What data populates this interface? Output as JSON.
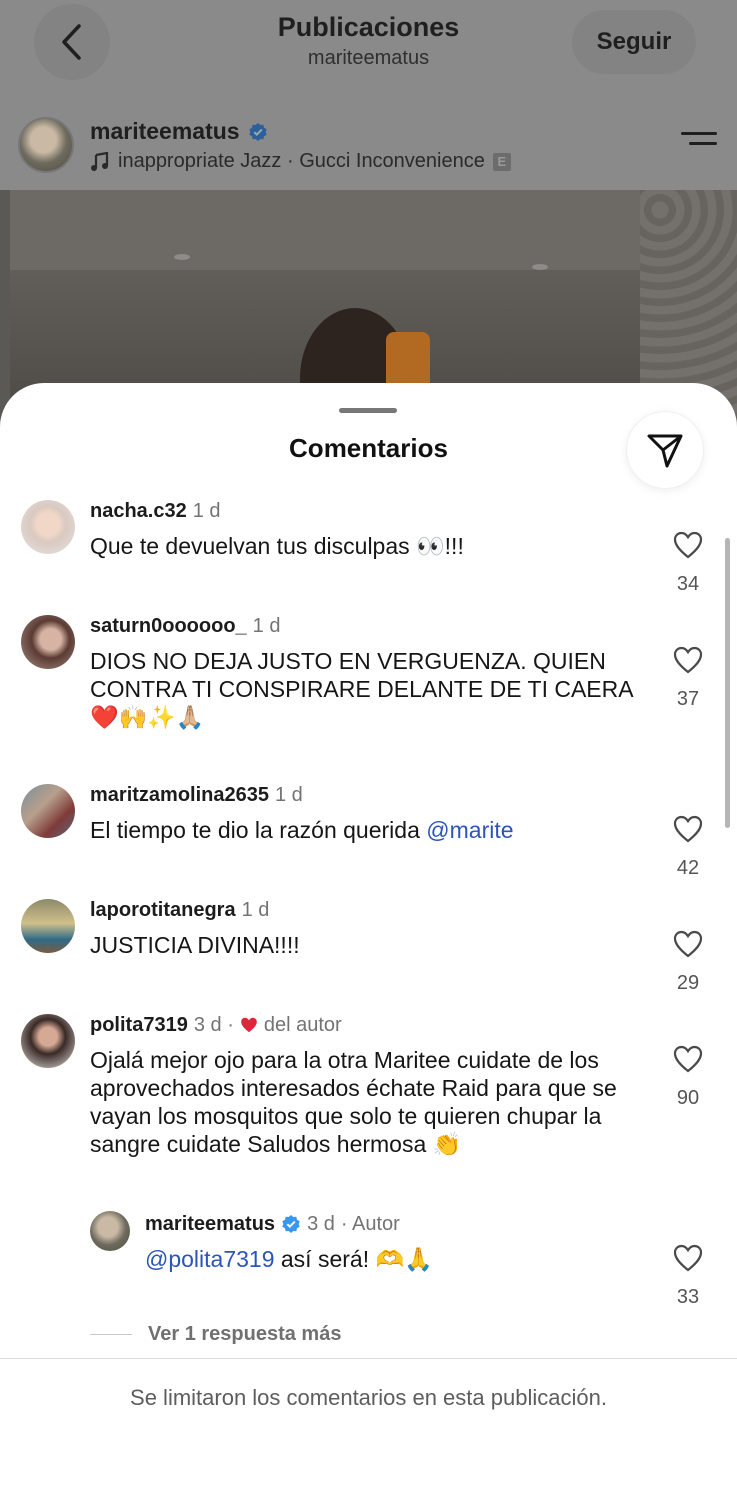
{
  "header": {
    "title": "Publicaciones",
    "subtitle": "mariteematus",
    "follow_label": "Seguir"
  },
  "post": {
    "username": "mariteematus",
    "music": "inappropriate Jazz · Gucci Inconvenience",
    "explicit_badge": "E"
  },
  "sheet": {
    "title": "Comentarios",
    "footer_notice": "Se limitaron los comentarios en esta publicación.",
    "more_replies_label": "Ver 1 respuesta más"
  },
  "comments": [
    {
      "username": "nacha.c32",
      "time": "1 d",
      "text": "Que te devuelvan tus disculpas 👀!!!",
      "likes": "34"
    },
    {
      "username": "saturn0oooooo_",
      "time": "1 d",
      "text": "DIOS NO DEJA JUSTO EN VERGUENZA. QUIEN CONTRA TI CONSPIRARE DELANTE DE TI CAERA ❤️🙌✨🙏🏼",
      "likes": "37"
    },
    {
      "username": "maritzamolina2635",
      "time": "1 d",
      "text": "El tiempo te dio la razón querida ",
      "mention": "@marite",
      "likes": "42"
    },
    {
      "username": "laporotitanegra",
      "time": "1 d",
      "text": "JUSTICIA DIVINA!!!!",
      "likes": "29"
    },
    {
      "username": "polita7319",
      "time": "3 d ·",
      "author_liked": "del autor",
      "text": "Ojalá mejor ojo para la otra Maritee cuidate de los aprovechados interesados échate Raid para que se vayan los mosquitos que solo te quieren chupar la sangre  cuidate Saludos hermosa 👏",
      "likes": "90"
    }
  ],
  "reply": {
    "username": "mariteematus",
    "time": "3 d",
    "author_tag": "· Autor",
    "mention": "@polita7319",
    "text": " así será! 🫶🙏",
    "likes": "33"
  },
  "colors": {
    "accent_link": "#2b55b8",
    "verified_blue": "#3797f0",
    "heart_red": "#e0243a",
    "dim_overlay": "#8a8a8a"
  },
  "icons": {
    "back": "chevron-left-icon",
    "menu": "menu-icon",
    "share": "send-icon",
    "like": "heart-outline-icon",
    "verified": "verified-badge-icon",
    "music": "music-note-icon"
  }
}
